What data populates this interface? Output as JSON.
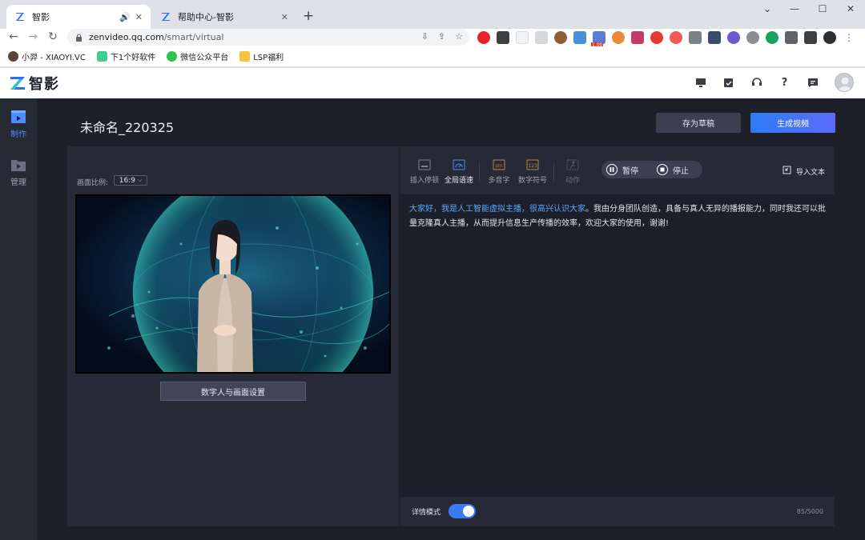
{
  "browser": {
    "tabs": [
      {
        "title": "智影",
        "active": true
      },
      {
        "title": "帮助中心-智影",
        "active": false
      }
    ],
    "url_host": "zenvideo.qq.com",
    "url_path": "/smart/virtual",
    "bookmarks": [
      {
        "label": "小羿 - XIAOYI.VC"
      },
      {
        "label": "下1个好软件"
      },
      {
        "label": "微信公众平台"
      },
      {
        "label": "LSP福利"
      }
    ],
    "ext_badge": "1.00"
  },
  "app": {
    "brand": "智影",
    "sidebar": [
      {
        "label": "制作",
        "active": true
      },
      {
        "label": "管理",
        "active": false
      }
    ],
    "doc_title": "未命名_220325",
    "save_draft_label": "存为草稿",
    "generate_label": "生成视频",
    "ratio_label": "画面比例:",
    "ratio_value": "16:9",
    "settings_label": "数字人与画面设置",
    "tools": [
      {
        "label": "插入停顿"
      },
      {
        "label": "全局语速"
      },
      {
        "label": "多音字"
      },
      {
        "label": "数字符号"
      },
      {
        "label": "动作"
      }
    ],
    "pause_label": "暂停",
    "stop_label": "停止",
    "import_label": "导入文本",
    "script_highlight": "大家好，我是人工智能虚拟主播，很高兴认识大家",
    "script_rest": "。我由分身团队创造，具备与真人无异的播报能力，同时我还可以批量克隆真人主播，从而提升信息生产传播的效率，欢迎大家的使用，谢谢!",
    "detail_mode_label": "详情模式",
    "detail_mode_on": true,
    "char_count": "85/5000"
  },
  "colors": {
    "accent": "#2e7bf6",
    "highlight_text": "#5aa8ff",
    "app_bg": "#1d2029"
  }
}
